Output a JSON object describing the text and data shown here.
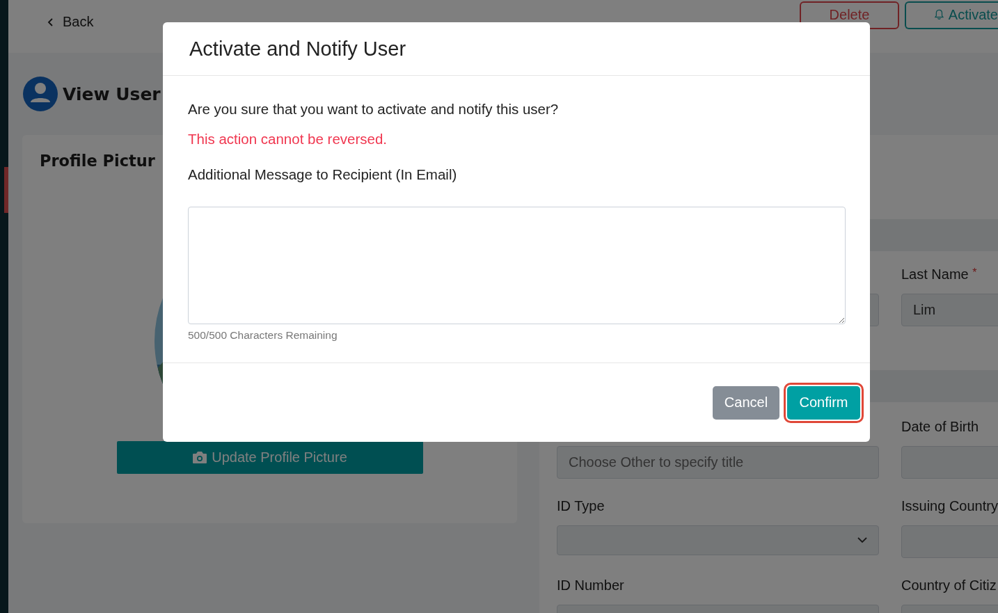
{
  "topbar": {
    "back": "Back",
    "buttons": [
      {
        "label": "Delete",
        "kind": "danger"
      },
      {
        "label": "Activate",
        "kind": "activate"
      }
    ]
  },
  "page_title": "View User",
  "profile_card": {
    "title": "Profile Pictur",
    "button": "Update Profile Picture"
  },
  "form": {
    "sections": [
      {
        "fields": [
          {
            "kind": "text"
          },
          {
            "label": "Last Name",
            "required_mark": "*",
            "value": "Lim",
            "kind": "text"
          }
        ]
      },
      {
        "fields": [
          {
            "placeholder": "Choose Other to specify title",
            "kind": "text"
          },
          {
            "label": "Date of Birth",
            "kind": "text"
          },
          {
            "label": "ID Type",
            "kind": "select"
          },
          {
            "label": "Issuing Country",
            "kind": "text"
          },
          {
            "label": "ID Number",
            "kind": "text"
          },
          {
            "label": "Country of Citiz",
            "kind": "text"
          }
        ]
      }
    ]
  },
  "dialog": {
    "title": "Activate and Notify User",
    "question": "Are you sure that you want to activate and notify this user?",
    "warning": "This action cannot be reversed.",
    "message_label": "Additional Message to Recipient (In Email)",
    "counter": "500/500 Characters Remaining",
    "buttons": [
      {
        "label": "Cancel",
        "kind": "secondary",
        "focused": false
      },
      {
        "label": "Confirm",
        "kind": "primary",
        "focused": true
      }
    ]
  }
}
